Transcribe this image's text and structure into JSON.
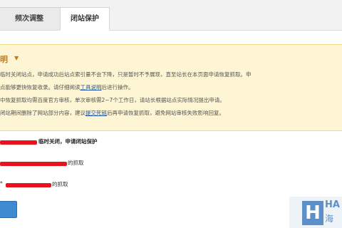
{
  "tabs": [
    {
      "label": "频次调整"
    },
    {
      "label": "闭站保护"
    }
  ],
  "notice": {
    "title": "明",
    "lines": [
      "临时关闭站点，申请成功后站点索引量不会下降，只是暂时不予展现，直至站长在本页面申请恢复抓取。申",
      "点能够更快恢复收录。请仔细阅读",
      "后进行操作。",
      "中恢复抓取均需百度官方审核，单次审核需2~7个工作日，请站长根据站点实际情况提出申请。",
      "闭站期间删除了网站部分内容，建议",
      "后再申请恢复抓取，避免网站审核失败影响回复。"
    ],
    "link_tool_guide": "工具说明",
    "link_submit_dead": "提交死链"
  },
  "form": {
    "line1_suffix": "临时关闭，申请闭站保护",
    "line2_suffix": "的抓取",
    "line3_prefix": "*",
    "line3_suffix": "的抓取"
  },
  "colors": {
    "notice_bg": "#fdf5d4",
    "notice_title": "#c57a1b",
    "redaction": "#e8131f",
    "button": "#3d8ad0"
  },
  "logo": {
    "mark": "H",
    "text_top": "HA",
    "text_bottom": "海"
  }
}
